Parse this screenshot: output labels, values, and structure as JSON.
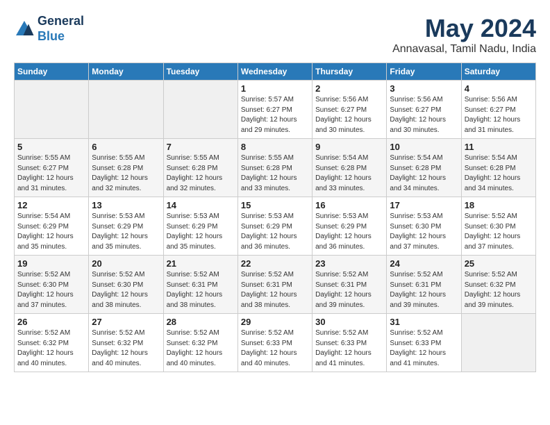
{
  "header": {
    "logo_line1": "General",
    "logo_line2": "Blue",
    "month_title": "May 2024",
    "location": "Annavasal, Tamil Nadu, India"
  },
  "days_of_week": [
    "Sunday",
    "Monday",
    "Tuesday",
    "Wednesday",
    "Thursday",
    "Friday",
    "Saturday"
  ],
  "weeks": [
    [
      {
        "day": "",
        "info": ""
      },
      {
        "day": "",
        "info": ""
      },
      {
        "day": "",
        "info": ""
      },
      {
        "day": "1",
        "info": "Sunrise: 5:57 AM\nSunset: 6:27 PM\nDaylight: 12 hours\nand 29 minutes."
      },
      {
        "day": "2",
        "info": "Sunrise: 5:56 AM\nSunset: 6:27 PM\nDaylight: 12 hours\nand 30 minutes."
      },
      {
        "day": "3",
        "info": "Sunrise: 5:56 AM\nSunset: 6:27 PM\nDaylight: 12 hours\nand 30 minutes."
      },
      {
        "day": "4",
        "info": "Sunrise: 5:56 AM\nSunset: 6:27 PM\nDaylight: 12 hours\nand 31 minutes."
      }
    ],
    [
      {
        "day": "5",
        "info": "Sunrise: 5:55 AM\nSunset: 6:27 PM\nDaylight: 12 hours\nand 31 minutes."
      },
      {
        "day": "6",
        "info": "Sunrise: 5:55 AM\nSunset: 6:28 PM\nDaylight: 12 hours\nand 32 minutes."
      },
      {
        "day": "7",
        "info": "Sunrise: 5:55 AM\nSunset: 6:28 PM\nDaylight: 12 hours\nand 32 minutes."
      },
      {
        "day": "8",
        "info": "Sunrise: 5:55 AM\nSunset: 6:28 PM\nDaylight: 12 hours\nand 33 minutes."
      },
      {
        "day": "9",
        "info": "Sunrise: 5:54 AM\nSunset: 6:28 PM\nDaylight: 12 hours\nand 33 minutes."
      },
      {
        "day": "10",
        "info": "Sunrise: 5:54 AM\nSunset: 6:28 PM\nDaylight: 12 hours\nand 34 minutes."
      },
      {
        "day": "11",
        "info": "Sunrise: 5:54 AM\nSunset: 6:28 PM\nDaylight: 12 hours\nand 34 minutes."
      }
    ],
    [
      {
        "day": "12",
        "info": "Sunrise: 5:54 AM\nSunset: 6:29 PM\nDaylight: 12 hours\nand 35 minutes."
      },
      {
        "day": "13",
        "info": "Sunrise: 5:53 AM\nSunset: 6:29 PM\nDaylight: 12 hours\nand 35 minutes."
      },
      {
        "day": "14",
        "info": "Sunrise: 5:53 AM\nSunset: 6:29 PM\nDaylight: 12 hours\nand 35 minutes."
      },
      {
        "day": "15",
        "info": "Sunrise: 5:53 AM\nSunset: 6:29 PM\nDaylight: 12 hours\nand 36 minutes."
      },
      {
        "day": "16",
        "info": "Sunrise: 5:53 AM\nSunset: 6:29 PM\nDaylight: 12 hours\nand 36 minutes."
      },
      {
        "day": "17",
        "info": "Sunrise: 5:53 AM\nSunset: 6:30 PM\nDaylight: 12 hours\nand 37 minutes."
      },
      {
        "day": "18",
        "info": "Sunrise: 5:52 AM\nSunset: 6:30 PM\nDaylight: 12 hours\nand 37 minutes."
      }
    ],
    [
      {
        "day": "19",
        "info": "Sunrise: 5:52 AM\nSunset: 6:30 PM\nDaylight: 12 hours\nand 37 minutes."
      },
      {
        "day": "20",
        "info": "Sunrise: 5:52 AM\nSunset: 6:30 PM\nDaylight: 12 hours\nand 38 minutes."
      },
      {
        "day": "21",
        "info": "Sunrise: 5:52 AM\nSunset: 6:31 PM\nDaylight: 12 hours\nand 38 minutes."
      },
      {
        "day": "22",
        "info": "Sunrise: 5:52 AM\nSunset: 6:31 PM\nDaylight: 12 hours\nand 38 minutes."
      },
      {
        "day": "23",
        "info": "Sunrise: 5:52 AM\nSunset: 6:31 PM\nDaylight: 12 hours\nand 39 minutes."
      },
      {
        "day": "24",
        "info": "Sunrise: 5:52 AM\nSunset: 6:31 PM\nDaylight: 12 hours\nand 39 minutes."
      },
      {
        "day": "25",
        "info": "Sunrise: 5:52 AM\nSunset: 6:32 PM\nDaylight: 12 hours\nand 39 minutes."
      }
    ],
    [
      {
        "day": "26",
        "info": "Sunrise: 5:52 AM\nSunset: 6:32 PM\nDaylight: 12 hours\nand 40 minutes."
      },
      {
        "day": "27",
        "info": "Sunrise: 5:52 AM\nSunset: 6:32 PM\nDaylight: 12 hours\nand 40 minutes."
      },
      {
        "day": "28",
        "info": "Sunrise: 5:52 AM\nSunset: 6:32 PM\nDaylight: 12 hours\nand 40 minutes."
      },
      {
        "day": "29",
        "info": "Sunrise: 5:52 AM\nSunset: 6:33 PM\nDaylight: 12 hours\nand 40 minutes."
      },
      {
        "day": "30",
        "info": "Sunrise: 5:52 AM\nSunset: 6:33 PM\nDaylight: 12 hours\nand 41 minutes."
      },
      {
        "day": "31",
        "info": "Sunrise: 5:52 AM\nSunset: 6:33 PM\nDaylight: 12 hours\nand 41 minutes."
      },
      {
        "day": "",
        "info": ""
      }
    ]
  ]
}
